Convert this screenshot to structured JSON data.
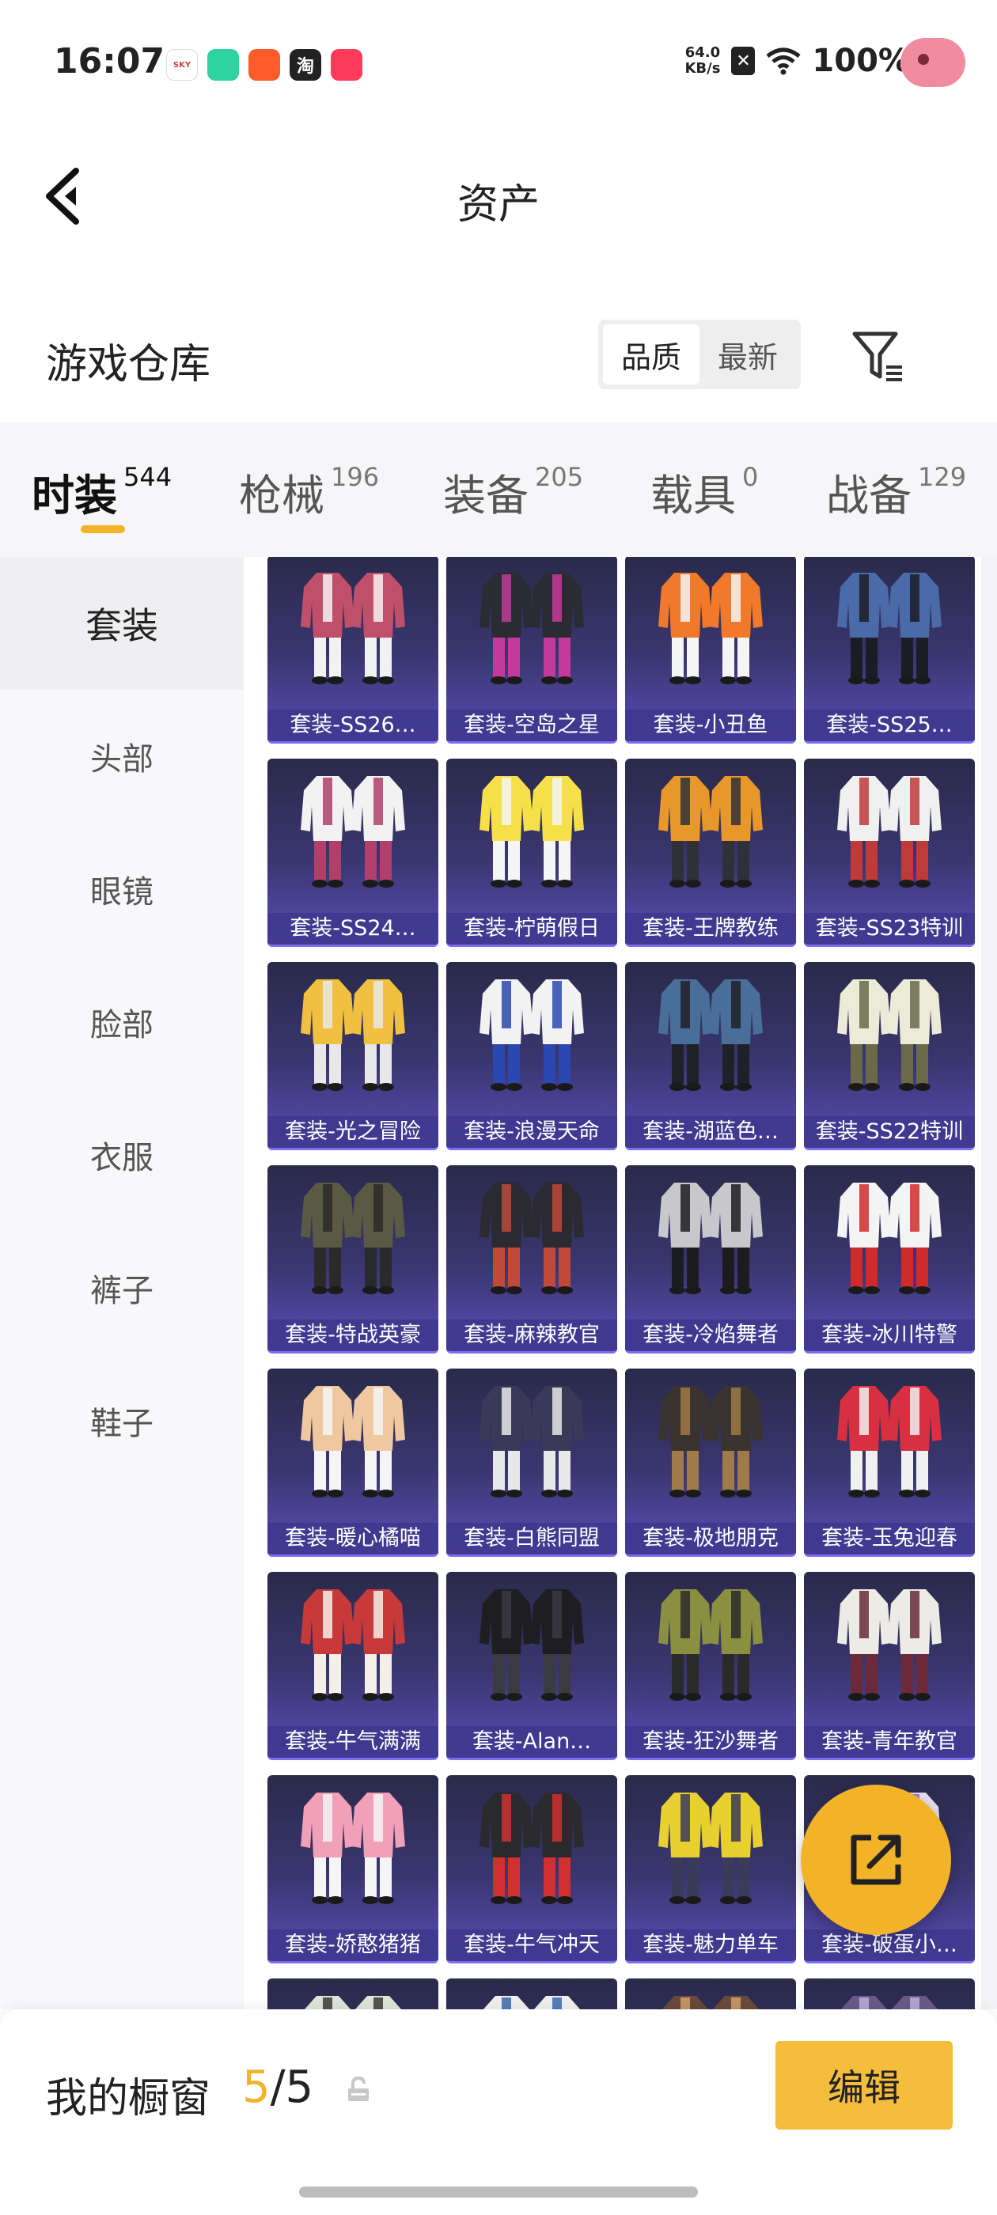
{
  "status_bar": {
    "time": "16:07",
    "app_icons": [
      "SKY",
      "",
      "",
      "淘",
      ""
    ],
    "net_speed_value": "64.0",
    "net_speed_unit": "KB/s",
    "battery": "100%"
  },
  "header": {
    "title": "资产"
  },
  "section": {
    "title": "游戏仓库",
    "sort_options": [
      "品质",
      "最新"
    ],
    "sort_selected": "品质"
  },
  "tabs": [
    {
      "label": "时装",
      "count": "544",
      "active": true
    },
    {
      "label": "枪械",
      "count": "196",
      "active": false
    },
    {
      "label": "装备",
      "count": "205",
      "active": false
    },
    {
      "label": "载具",
      "count": "0",
      "active": false
    },
    {
      "label": "战备",
      "count": "129",
      "active": false
    }
  ],
  "sidebar": {
    "items": [
      {
        "label": "套装",
        "active": true
      },
      {
        "label": "头部",
        "active": false
      },
      {
        "label": "眼镜",
        "active": false
      },
      {
        "label": "脸部",
        "active": false
      },
      {
        "label": "衣服",
        "active": false
      },
      {
        "label": "裤子",
        "active": false
      },
      {
        "label": "鞋子",
        "active": false
      }
    ]
  },
  "items": [
    {
      "name": "套装-SS26…",
      "color": "#c0506a",
      "accent": "#f2f2f2"
    },
    {
      "name": "套装-空岛之星",
      "color": "#2b2b34",
      "accent": "#c43a9a"
    },
    {
      "name": "套装-小丑鱼",
      "color": "#f07a2a",
      "accent": "#f5f5f5"
    },
    {
      "name": "套装-SS25…",
      "color": "#4a6aa8",
      "accent": "#1c1c24"
    },
    {
      "name": "套装-SS24…",
      "color": "#f2f2f2",
      "accent": "#b0406a"
    },
    {
      "name": "套装-柠萌假日",
      "color": "#f5e04a",
      "accent": "#f5f5f5"
    },
    {
      "name": "套装-王牌教练",
      "color": "#e8982a",
      "accent": "#303038"
    },
    {
      "name": "套装-SS23特训",
      "color": "#f0f0f0",
      "accent": "#c03a3a"
    },
    {
      "name": "套装-光之冒险",
      "color": "#f2c040",
      "accent": "#e8e8e8"
    },
    {
      "name": "套装-浪漫天命",
      "color": "#f2f2f2",
      "accent": "#2a48b0"
    },
    {
      "name": "套装-湖蓝色…",
      "color": "#4a6e9a",
      "accent": "#202028"
    },
    {
      "name": "套装-SS22特训",
      "color": "#ecebd8",
      "accent": "#6a6a4a"
    },
    {
      "name": "套装-特战英豪",
      "color": "#5a5a44",
      "accent": "#2a2a2a"
    },
    {
      "name": "套装-麻辣教官",
      "color": "#2a2a30",
      "accent": "#c04a3a"
    },
    {
      "name": "套装-冷焰舞者",
      "color": "#c8c8cc",
      "accent": "#1c1c20"
    },
    {
      "name": "套装-冰川特警",
      "color": "#f4f4f4",
      "accent": "#d02a2a"
    },
    {
      "name": "套装-暖心橘喵",
      "color": "#f0c8a0",
      "accent": "#f5f5f5"
    },
    {
      "name": "套装-白熊同盟",
      "color": "#3a3a58",
      "accent": "#e8e8e8"
    },
    {
      "name": "套装-极地朋克",
      "color": "#3a3430",
      "accent": "#a07a48"
    },
    {
      "name": "套装-玉兔迎春",
      "color": "#d83040",
      "accent": "#f0f0f0"
    },
    {
      "name": "套装-牛气满满",
      "color": "#c83a3a",
      "accent": "#f4f0e8"
    },
    {
      "name": "套装-Alan…",
      "color": "#1e1e22",
      "accent": "#3a3a40"
    },
    {
      "name": "套装-狂沙舞者",
      "color": "#8a9040",
      "accent": "#2a2a2a"
    },
    {
      "name": "套装-青年教官",
      "color": "#ecebe6",
      "accent": "#6a2a3a"
    },
    {
      "name": "套装-娇憨猪猪",
      "color": "#f0a0b8",
      "accent": "#f5f5f5"
    },
    {
      "name": "套装-牛气冲天",
      "color": "#2a2a2e",
      "accent": "#d03030"
    },
    {
      "name": "套装-魅力单车",
      "color": "#e8d030",
      "accent": "#3a3a5a"
    },
    {
      "name": "套装-破蛋小…",
      "color": "#e8e0f0",
      "accent": "#9a6ac8"
    },
    {
      "name": "",
      "color": "#e0e4d8",
      "accent": "#3a3a3a"
    },
    {
      "name": "",
      "color": "#f0f0f0",
      "accent": "#3a6ab0"
    },
    {
      "name": "",
      "color": "#6a4a3a",
      "accent": "#d0a070"
    },
    {
      "name": "",
      "color": "#6a5a8a",
      "accent": "#c0b0e0"
    }
  ],
  "bottom_bar": {
    "showcase_label": "我的橱窗",
    "showcase_current": "5",
    "showcase_sep": "/",
    "showcase_total": "5",
    "edit_label": "编辑"
  },
  "colors": {
    "accent": "#f2b328",
    "card_gradient_bottom": "#5a4db8"
  }
}
